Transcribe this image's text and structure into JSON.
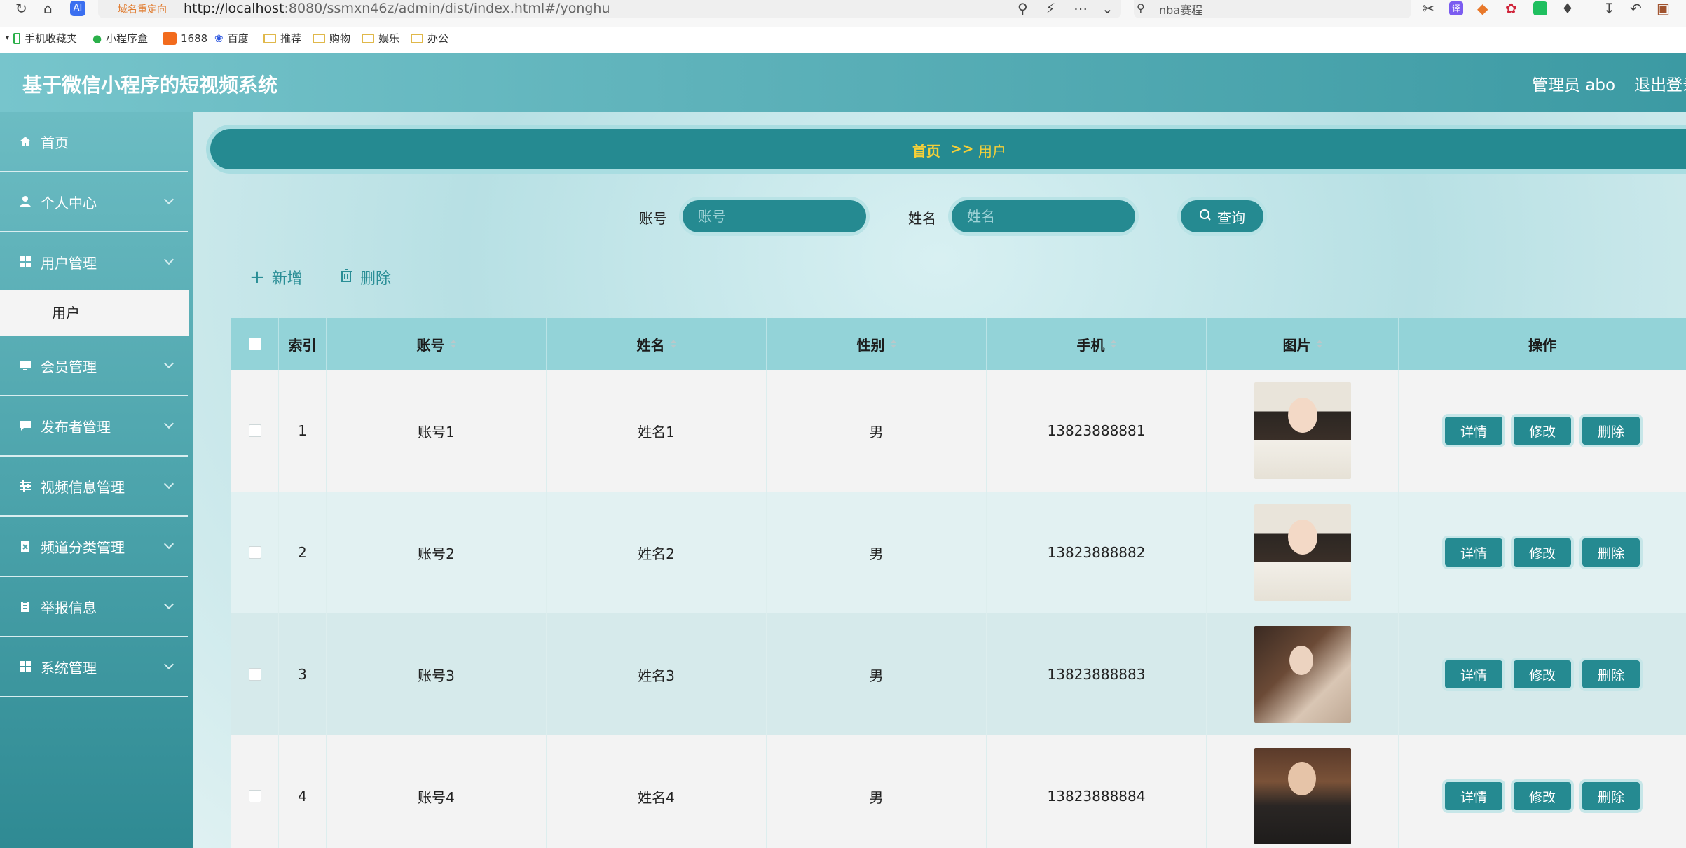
{
  "browser": {
    "redirect_label": "域名重定向",
    "url_host": "http://localhost",
    "url_rest": ":8080/ssmxn46z/admin/dist/index.html#/yonghu",
    "search_text": "nba赛程",
    "bookmarks": [
      "手机收藏夹",
      "小程序盒",
      "1688",
      "百度",
      "推荐",
      "购物",
      "娱乐",
      "办公"
    ]
  },
  "header": {
    "title": "基于微信小程序的短视频系统",
    "admin": "管理员 abo",
    "logout": "退出登录"
  },
  "sidebar": {
    "items": [
      {
        "label": "首页",
        "icon": "home-icon"
      },
      {
        "label": "个人中心",
        "icon": "user-icon"
      },
      {
        "label": "用户管理",
        "icon": "grid-icon"
      },
      {
        "label": "会员管理",
        "icon": "monitor-icon"
      },
      {
        "label": "发布者管理",
        "icon": "chat-icon"
      },
      {
        "label": "视频信息管理",
        "icon": "sliders-icon"
      },
      {
        "label": "频道分类管理",
        "icon": "delete-doc-icon"
      },
      {
        "label": "举报信息",
        "icon": "clipboard-icon"
      },
      {
        "label": "系统管理",
        "icon": "grid-icon"
      }
    ],
    "active_sub": "用户"
  },
  "breadcrumb": {
    "home": "首页",
    "sep": ">>",
    "current": "用户"
  },
  "search": {
    "account_label": "账号",
    "account_placeholder": "账号",
    "name_label": "姓名",
    "name_placeholder": "姓名",
    "query_label": "查询"
  },
  "actions": {
    "add": "新增",
    "delete": "删除"
  },
  "table": {
    "headers": [
      "索引",
      "账号",
      "姓名",
      "性别",
      "手机",
      "图片",
      "操作"
    ],
    "rows": [
      {
        "index": "1",
        "account": "账号1",
        "name": "姓名1",
        "gender": "男",
        "phone": "13823888881"
      },
      {
        "index": "2",
        "account": "账号2",
        "name": "姓名2",
        "gender": "男",
        "phone": "13823888882"
      },
      {
        "index": "3",
        "account": "账号3",
        "name": "姓名3",
        "gender": "男",
        "phone": "13823888883"
      },
      {
        "index": "4",
        "account": "账号4",
        "name": "姓名4",
        "gender": "男",
        "phone": "13823888884"
      }
    ],
    "row_buttons": {
      "detail": "详情",
      "edit": "修改",
      "delete": "删除"
    }
  },
  "colors": {
    "accent": "#258a91",
    "breadcrumb_text": "#f5d038",
    "header_bg": "#93d3d8"
  }
}
